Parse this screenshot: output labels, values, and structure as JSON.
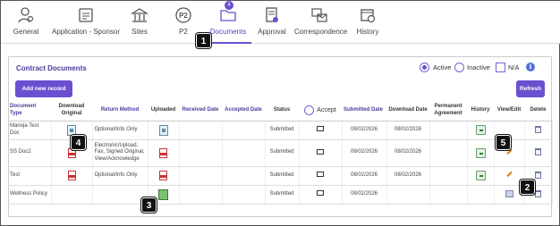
{
  "nav": {
    "tabs": [
      {
        "label": "General",
        "icon": "user-settings-icon"
      },
      {
        "label": "Application - Sponsor",
        "icon": "id-card-icon"
      },
      {
        "label": "Sites",
        "icon": "building-icon"
      },
      {
        "label": "P2",
        "icon": "p2-circle-icon"
      },
      {
        "label": "Documents",
        "icon": "folder-icon",
        "badge": "4",
        "active": true
      },
      {
        "label": "Approval",
        "icon": "approval-doc-icon"
      },
      {
        "label": "Correspondence",
        "icon": "correspondence-icon"
      },
      {
        "label": "History",
        "icon": "calendar-clock-icon"
      }
    ]
  },
  "callouts": [
    "1",
    "2",
    "3",
    "4",
    "5"
  ],
  "panel": {
    "title": "Contract Documents",
    "filter": {
      "active": "Active",
      "inactive": "Inactive",
      "na": "N/A",
      "selected": "Active"
    },
    "add_button": "Add new record",
    "refresh_button": "Refresh"
  },
  "table": {
    "headers": {
      "doc_type": "Document Type",
      "download_original": "Download Original",
      "return_method": "Return Method",
      "uploaded": "Uploaded",
      "received_date": "Received Date",
      "accepted_date": "Accepted Date",
      "status": "Status",
      "accept": "Accept",
      "submitted_date": "Submitted Date",
      "download_date": "Download Date",
      "permanent_agreement": "Permanent Agreement",
      "history": "History",
      "view_edit": "View/Edit",
      "delete": "Delete"
    },
    "rows": [
      {
        "doc_type": "Manoja Test Doc",
        "return_method": "Optional/Info Only",
        "status": "Submitted",
        "submitted_date": "08/02/2026",
        "download_date": "08/02/2026"
      },
      {
        "doc_type": "SS Doc2",
        "return_method": "Electronic/Upload, Fax, Signed Original, View/Acknowledge",
        "status": "Submitted",
        "submitted_date": "08/02/2026",
        "download_date": "08/02/2026"
      },
      {
        "doc_type": "Test",
        "return_method": "Optional/Info Only",
        "status": "Submitted",
        "submitted_date": "08/02/2026",
        "download_date": "08/02/2026"
      },
      {
        "doc_type": "Wellness Policy",
        "return_method": "",
        "status": "Submitted",
        "submitted_date": "08/02/2026",
        "download_date": ""
      }
    ]
  },
  "colors": {
    "accent": "#6b4fd0",
    "title": "#4a3b9c"
  }
}
